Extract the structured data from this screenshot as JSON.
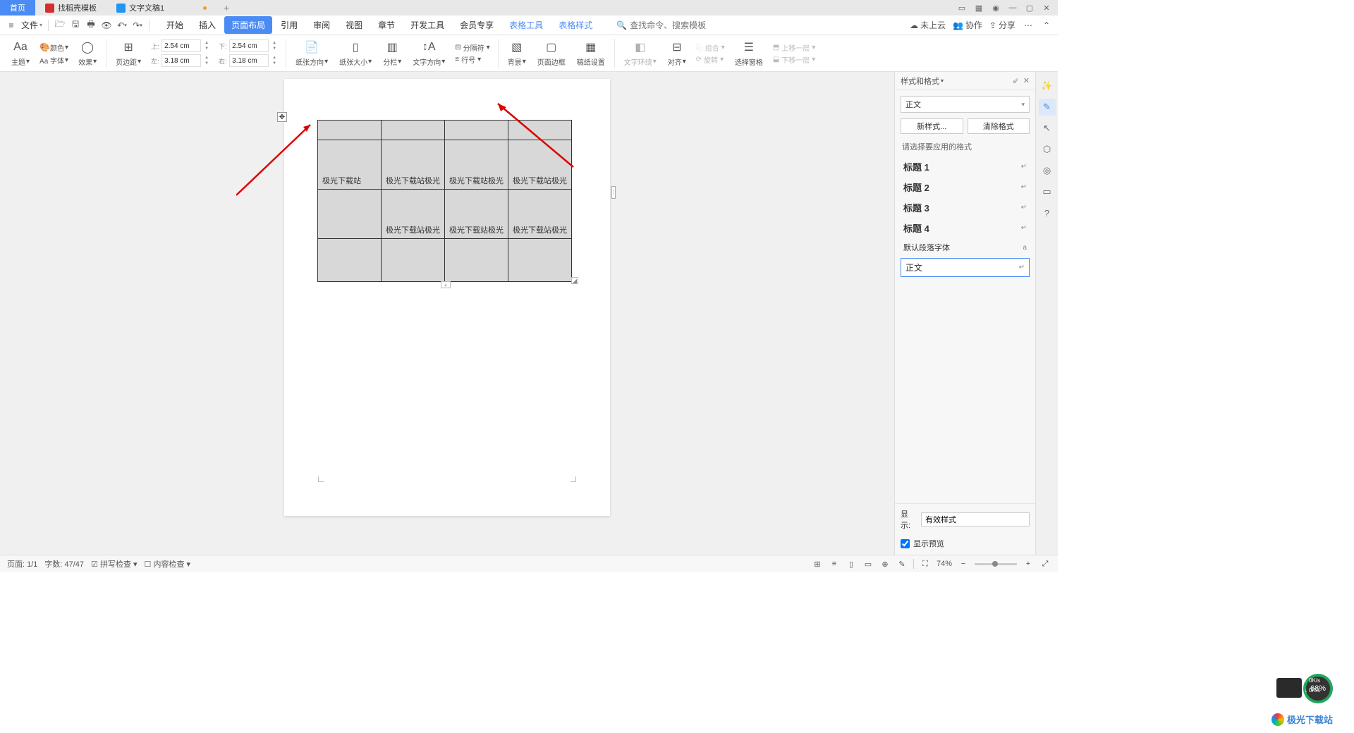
{
  "tabs": {
    "home": "首页",
    "template": "找稻壳模板",
    "doc": "文字文稿1"
  },
  "menu": {
    "file": "文件",
    "items": [
      "开始",
      "插入",
      "页面布局",
      "引用",
      "审阅",
      "视图",
      "章节",
      "开发工具",
      "会员专享",
      "表格工具",
      "表格样式"
    ],
    "active_index": 2,
    "context_start_index": 9,
    "search_placeholder": "查找命令、搜索模板"
  },
  "menu_right": {
    "cloud": "未上云",
    "coop": "协作",
    "share": "分享"
  },
  "ribbon": {
    "theme": "主题",
    "color": "颜色",
    "font": "Aa 字体",
    "effect": "效果",
    "margins": "页边距",
    "top": "2.54 cm",
    "bottom": "2.54 cm",
    "left": "3.18 cm",
    "right": "3.18 cm",
    "top_l": "上:",
    "bottom_l": "下:",
    "left_l": "左:",
    "right_l": "右:",
    "paper_dir": "纸张方向",
    "paper_size": "纸张大小",
    "columns": "分栏",
    "text_dir": "文字方向",
    "break": "分隔符",
    "line_no": "行号",
    "bg": "背景",
    "border": "页面边框",
    "wm": "稿纸设置",
    "wrap": "文字环绕",
    "align": "对齐",
    "rotate": "旋转",
    "group": "组合",
    "select_pane": "选择窗格",
    "up": "上移一层",
    "down": "下移一层"
  },
  "table": {
    "r1": [
      "极光下载站",
      "极光下载站极光",
      "极光下载站极光",
      "极光下载站极光"
    ],
    "r2": [
      "",
      "极光下载站极光",
      "极光下载站极光",
      "极光下载站极光"
    ]
  },
  "panel": {
    "title": "样式和格式",
    "current": "正文",
    "new_style": "新样式...",
    "clear": "清除格式",
    "hint": "请选择要应用的格式",
    "styles": [
      "标题 1",
      "标题 2",
      "标题 3",
      "标题 4"
    ],
    "default_font": "默认段落字体",
    "body": "正文",
    "show": "显示:",
    "show_val": "有效样式",
    "preview": "显示预览"
  },
  "status": {
    "page": "页面: 1/1",
    "words": "字数: 47/47",
    "spell": "拼写检查",
    "content": "内容检查",
    "zoom": "74%"
  },
  "gauge": "68%",
  "watermark": "极光下载站",
  "net_up": "↑ 0K/s",
  "net_dn": "↓ 0K/s"
}
